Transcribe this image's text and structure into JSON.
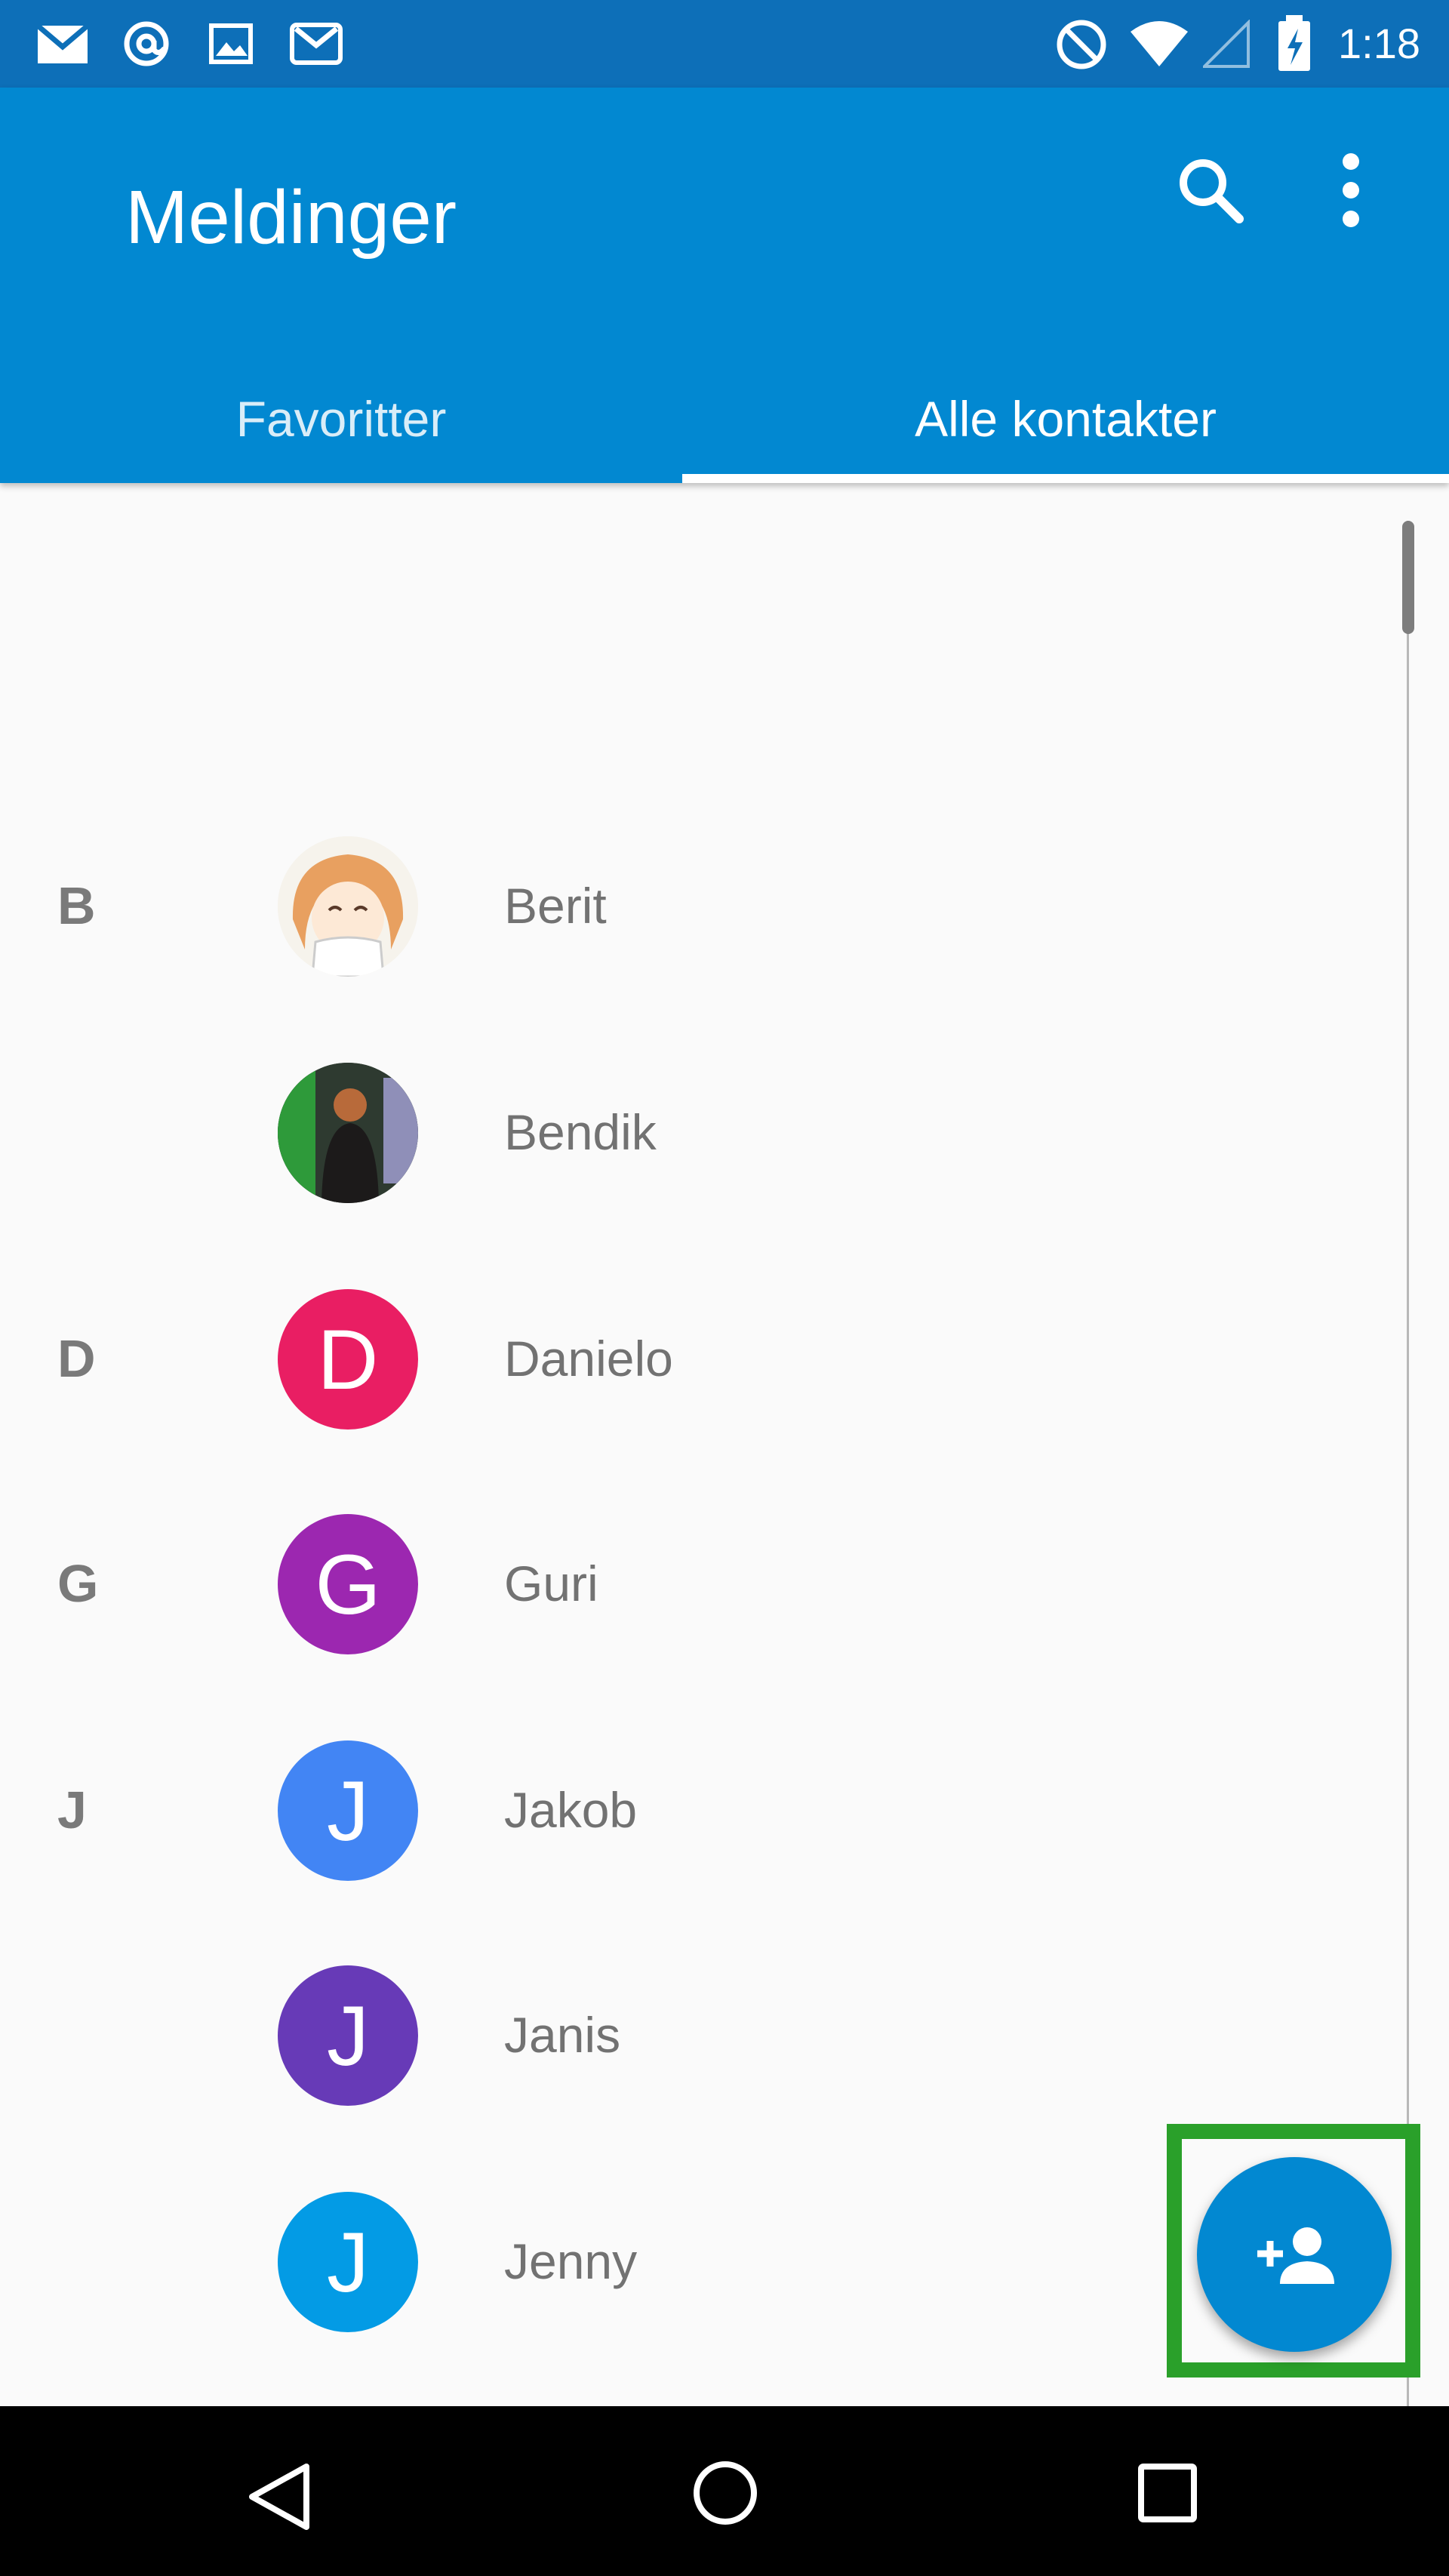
{
  "status_bar": {
    "time": "1:18",
    "icons": [
      "email-icon",
      "at-icon",
      "image-icon",
      "gmail-icon",
      "do-not-disturb-icon",
      "wifi-icon",
      "signal-icon",
      "battery-charging-icon"
    ]
  },
  "app_bar": {
    "title": "Meldinger",
    "actions": [
      "search-icon",
      "more-vert-icon"
    ]
  },
  "tabs": [
    {
      "label": "Favoritter",
      "selected": false
    },
    {
      "label": "Alle kontakter",
      "selected": true
    }
  ],
  "contacts": [
    {
      "section": "B",
      "name": "Berit",
      "avatar": "photo"
    },
    {
      "section": "",
      "name": "Bendik",
      "avatar": "photo"
    },
    {
      "section": "D",
      "name": "Danielo",
      "avatar_letter": "D",
      "avatar_color": "#e91e63"
    },
    {
      "section": "G",
      "name": "Guri",
      "avatar_letter": "G",
      "avatar_color": "#9c27b0"
    },
    {
      "section": "J",
      "name": "Jakob",
      "avatar_letter": "J",
      "avatar_color": "#4285f4"
    },
    {
      "section": "",
      "name": "Janis",
      "avatar_letter": "J",
      "avatar_color": "#673ab7"
    },
    {
      "section": "",
      "name": "Jenny",
      "avatar_letter": "J",
      "avatar_color": "#039be5"
    }
  ],
  "fab": {
    "icon": "add-person-icon",
    "color": "#0288d1"
  },
  "colors": {
    "primary": "#0288d1",
    "status_bar": "#0d6fb8",
    "highlight": "#2aa02a"
  },
  "nav_bar": {
    "icons": [
      "back-icon",
      "home-icon",
      "recents-icon"
    ]
  }
}
